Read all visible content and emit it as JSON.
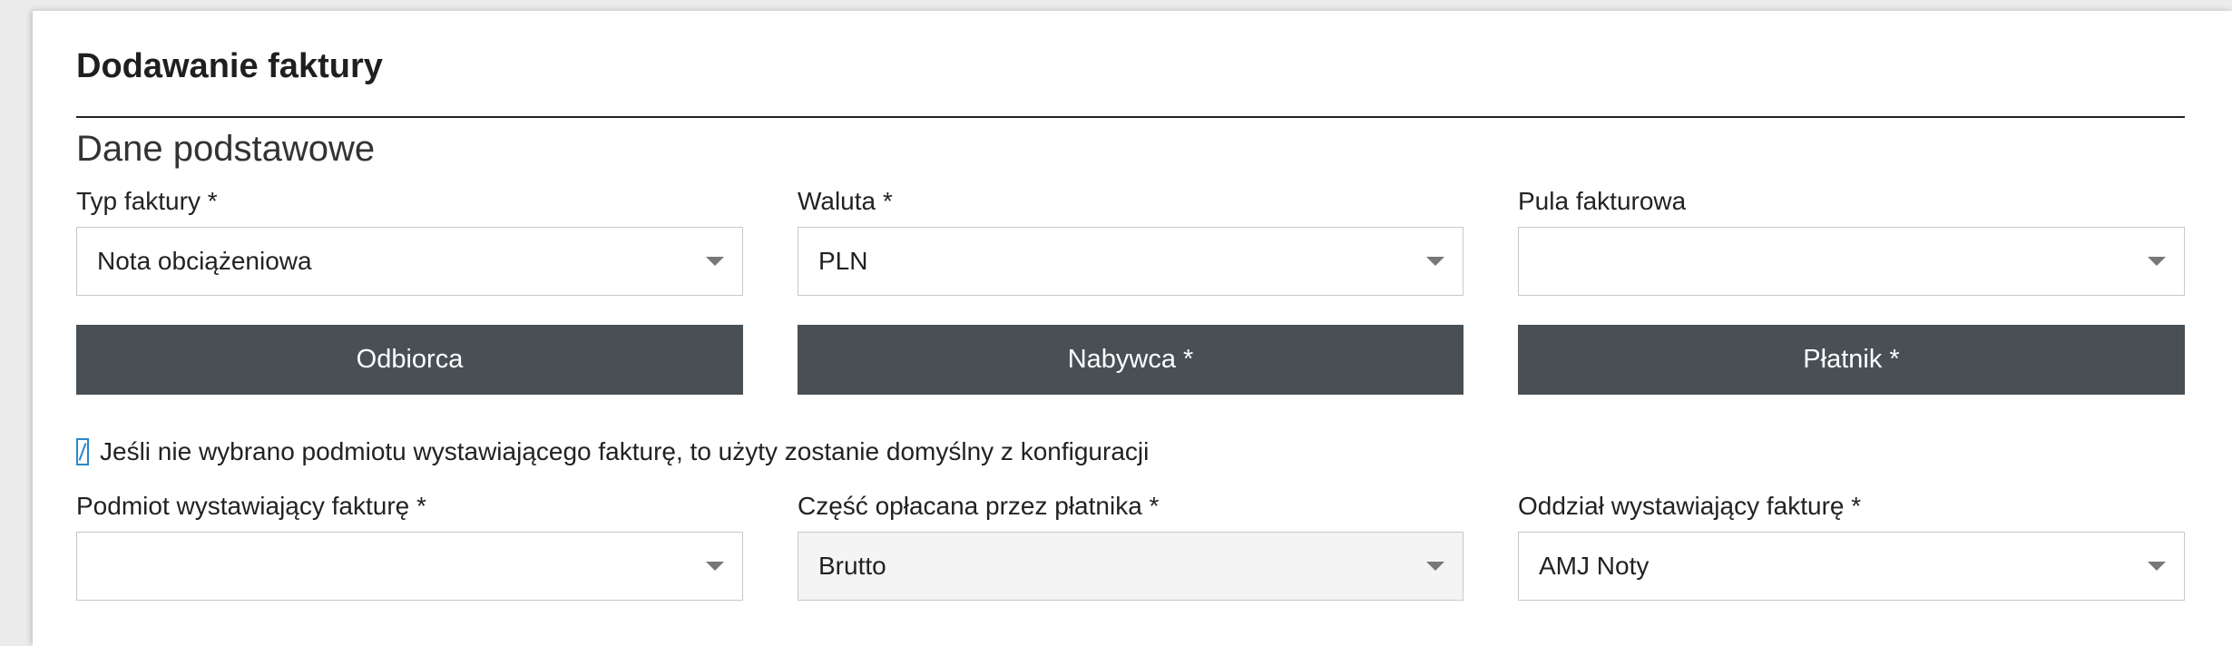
{
  "form": {
    "title": "Dodawanie faktury",
    "section_title": "Dane podstawowe",
    "fields_row1": [
      {
        "label": "Typ faktury *",
        "value": "Nota obciążeniowa"
      },
      {
        "label": "Waluta *",
        "value": "PLN"
      },
      {
        "label": "Pula fakturowa",
        "value": ""
      }
    ],
    "buttons": [
      {
        "label": "Odbiorca"
      },
      {
        "label": "Nabywca *"
      },
      {
        "label": "Płatnik *"
      }
    ],
    "info_text": "Jeśli nie wybrano podmiotu wystawiającego fakturę, to użyty zostanie domyślny z konfiguracji",
    "fields_row2": [
      {
        "label": "Podmiot wystawiający fakturę *",
        "value": ""
      },
      {
        "label": "Część opłacana przez płatnika *",
        "value": "Brutto"
      },
      {
        "label": "Oddział wystawiający fakturę *",
        "value": "AMJ Noty"
      }
    ]
  }
}
